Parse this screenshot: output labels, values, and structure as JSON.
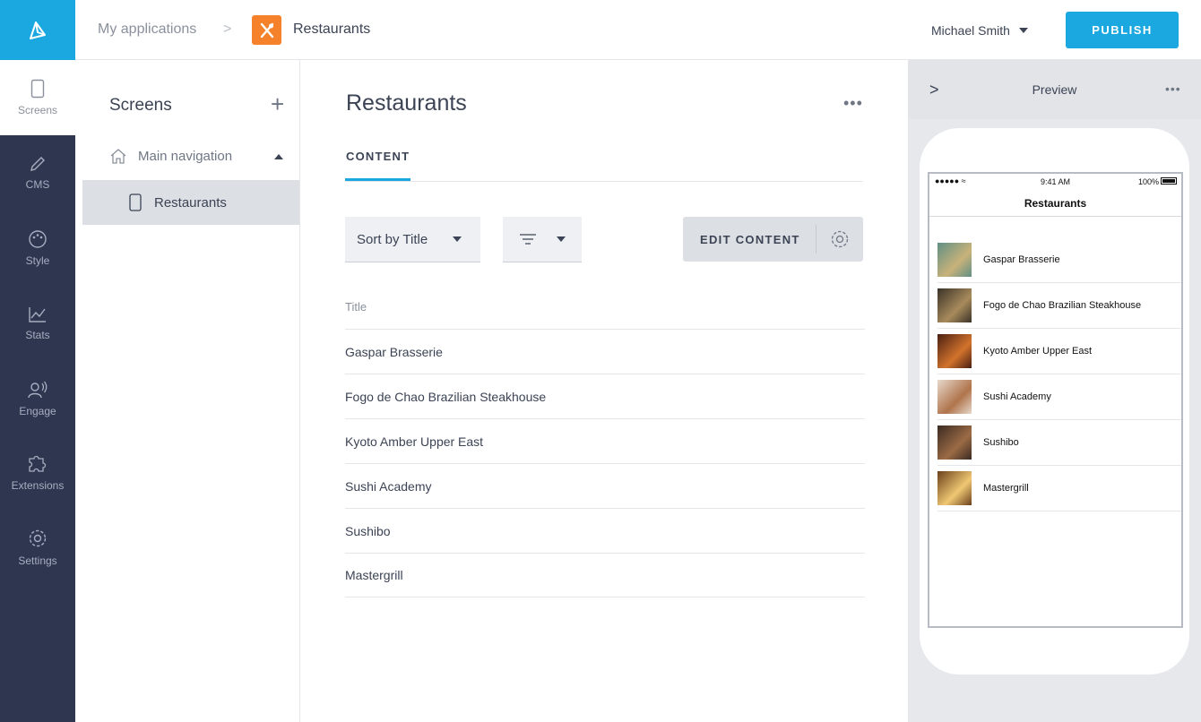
{
  "header": {
    "breadcrumb_root": "My applications",
    "breadcrumb_sep": ">",
    "app_name": "Restaurants",
    "user_name": "Michael Smith",
    "publish_label": "PUBLISH"
  },
  "colors": {
    "accent": "#1ba7df",
    "app_icon": "#f5822a",
    "sidebar_bg": "#2e3650"
  },
  "nav": {
    "items": [
      {
        "label": "Screens",
        "icon": "phone-icon"
      },
      {
        "label": "CMS",
        "icon": "pencil-icon"
      },
      {
        "label": "Style",
        "icon": "palette-icon"
      },
      {
        "label": "Stats",
        "icon": "chart-icon"
      },
      {
        "label": "Engage",
        "icon": "broadcast-user-icon"
      },
      {
        "label": "Extensions",
        "icon": "puzzle-icon"
      },
      {
        "label": "Settings",
        "icon": "gear-icon"
      }
    ]
  },
  "screens": {
    "title": "Screens",
    "add": "+",
    "main_navigation": "Main navigation",
    "selected_screen": "Restaurants"
  },
  "content": {
    "title": "Restaurants",
    "more": "•••",
    "tab": "CONTENT",
    "sort_label": "Sort by Title",
    "edit_label": "EDIT CONTENT",
    "column_title": "Title",
    "rows": [
      "Gaspar Brasserie",
      "Fogo de Chao Brazilian Steakhouse",
      "Kyoto Amber Upper East",
      "Sushi Academy",
      "Sushibo",
      "Mastergrill"
    ]
  },
  "preview": {
    "title": "Preview",
    "chevron": ">",
    "more": "•••",
    "status_signal": "●●●●● ≈",
    "status_time": "9:41 AM",
    "status_battery": "100%",
    "screen_title": "Restaurants",
    "items": [
      {
        "name": "Gaspar Brasserie",
        "thumb_a": "#5f8f84",
        "thumb_b": "#c9b27a"
      },
      {
        "name": "Fogo de Chao Brazilian Steakhouse",
        "thumb_a": "#3a3228",
        "thumb_b": "#a88b5c"
      },
      {
        "name": "Kyoto Amber Upper East",
        "thumb_a": "#4a1f12",
        "thumb_b": "#d2732c"
      },
      {
        "name": "Sushi Academy",
        "thumb_a": "#e7d9cc",
        "thumb_b": "#b0744b"
      },
      {
        "name": "Sushibo",
        "thumb_a": "#3b2a22",
        "thumb_b": "#9b6b45"
      },
      {
        "name": "Mastergrill",
        "thumb_a": "#6a3f1c",
        "thumb_b": "#f0c873"
      }
    ]
  }
}
